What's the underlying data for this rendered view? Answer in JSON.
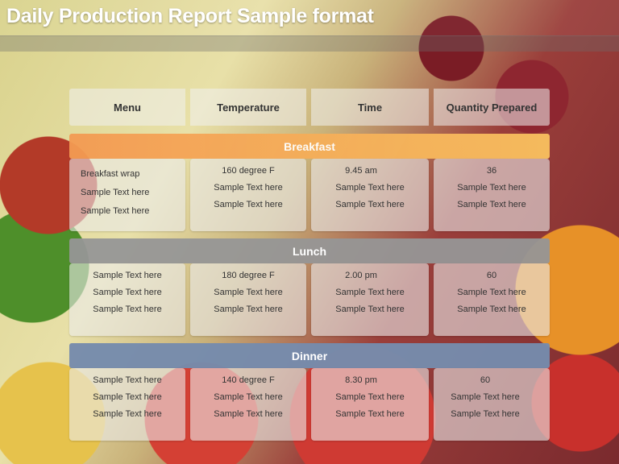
{
  "title": "Daily Production Report Sample format",
  "headers": [
    "Menu",
    "Temperature",
    "Time",
    "Quantity Prepared"
  ],
  "colors": {
    "breakfast": "#f7b35e",
    "lunch": "#9a9a9a",
    "dinner": "#7b8fae"
  },
  "sections": [
    {
      "label": "Breakfast",
      "columns": [
        [
          "Breakfast wrap",
          "Sample Text here",
          "Sample Text here"
        ],
        [
          "160 degree F",
          "Sample Text here",
          "Sample Text here"
        ],
        [
          "9.45 am",
          "Sample Text here",
          "Sample Text here"
        ],
        [
          "36",
          "Sample Text here",
          "Sample Text here"
        ]
      ]
    },
    {
      "label": "Lunch",
      "columns": [
        [
          "Sample Text here",
          "Sample Text here",
          "Sample Text here"
        ],
        [
          "180 degree F",
          "Sample Text here",
          "Sample Text here"
        ],
        [
          "2.00 pm",
          "Sample Text here",
          "Sample Text here"
        ],
        [
          "60",
          "Sample Text here",
          "Sample Text here"
        ]
      ]
    },
    {
      "label": "Dinner",
      "columns": [
        [
          "Sample Text here",
          "Sample Text here",
          "Sample Text here"
        ],
        [
          "140 degree F",
          "Sample Text here",
          "Sample Text here"
        ],
        [
          "8.30 pm",
          "Sample Text here",
          "Sample Text here"
        ],
        [
          "60",
          "Sample Text here",
          "Sample Text here"
        ]
      ]
    }
  ]
}
